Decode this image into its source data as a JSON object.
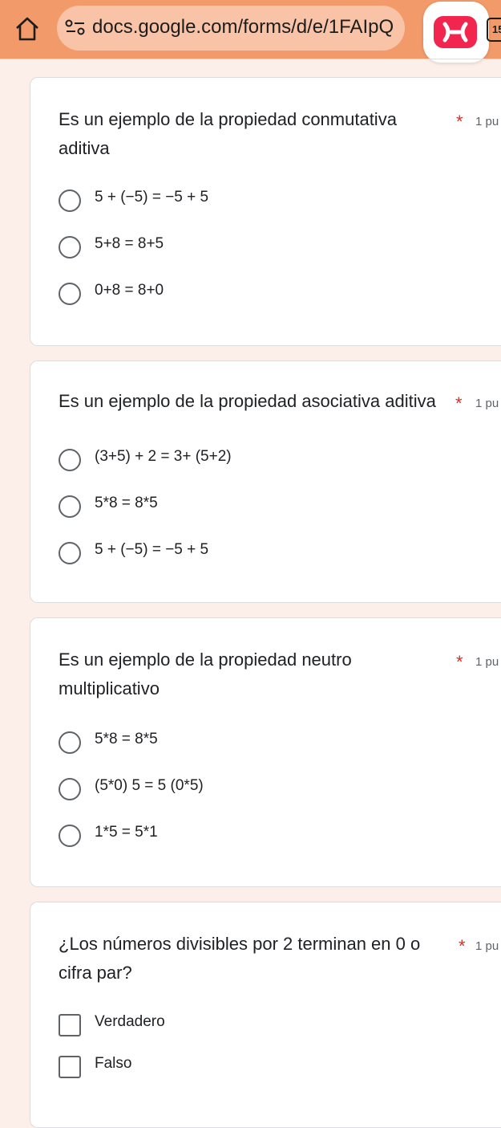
{
  "browser": {
    "url": "docs.google.com/forms/d/e/1FAIpQ",
    "tab_count": "15",
    "icons": {
      "home": "home-icon",
      "site_settings": "site-settings-icon",
      "extension": "extension-icon"
    },
    "colors": {
      "toolbar": "#f39a6a",
      "url_bar": "#f8c3a7",
      "extension": "#f2254f"
    }
  },
  "form": {
    "background": "#fcefe9",
    "questions": [
      {
        "title": "Es un ejemplo de la propiedad conmutativa aditiva",
        "required_mark": "*",
        "points": "1 pu",
        "type": "radio",
        "options": [
          "5 + (−5) = −5 + 5",
          "5+8 = 8+5",
          "0+8 = 8+0"
        ]
      },
      {
        "title": "Es un ejemplo de la propiedad asociativa aditiva",
        "required_mark": "*",
        "points": "1 pu",
        "type": "radio",
        "options": [
          "(3+5) + 2 = 3+ (5+2)",
          "5*8 = 8*5",
          "5 + (−5) = −5 + 5"
        ]
      },
      {
        "title": "Es un ejemplo de la propiedad neutro multiplicativo",
        "required_mark": "*",
        "points": "1 pu",
        "type": "radio",
        "options": [
          "5*8 = 8*5",
          "(5*0) 5 = 5 (0*5)",
          "1*5 = 5*1"
        ]
      },
      {
        "title": "¿Los números divisibles por 2 terminan en 0 o cifra par?",
        "required_mark": "*",
        "points": "1 pu",
        "type": "checkbox",
        "options": [
          "Verdadero",
          "Falso"
        ]
      }
    ]
  }
}
